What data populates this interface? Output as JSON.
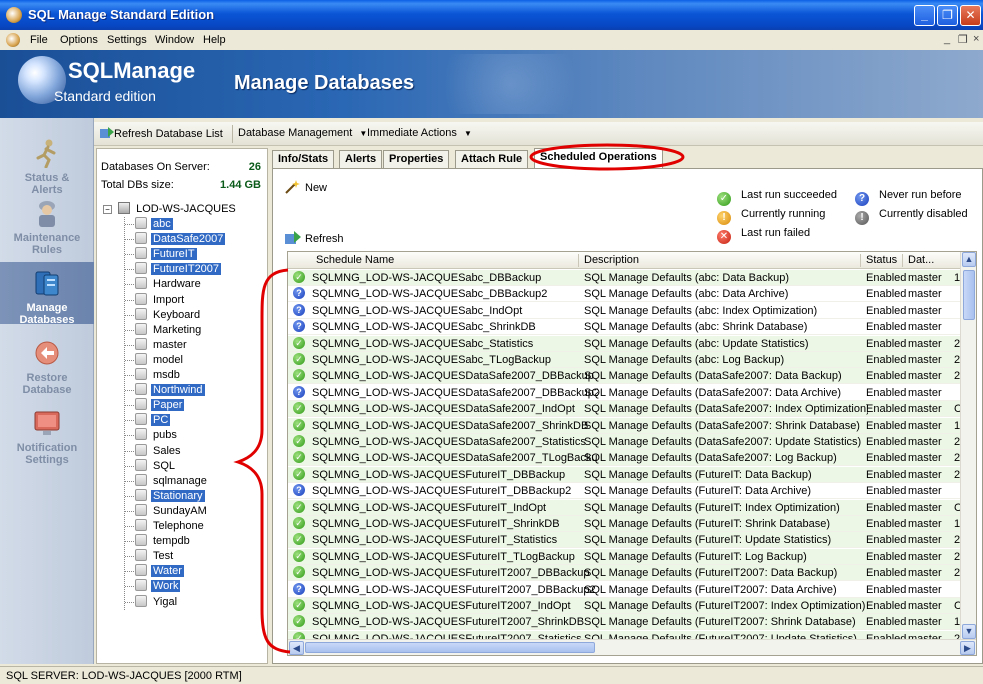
{
  "window": {
    "title": "SQL Manage Standard Edition"
  },
  "menu": {
    "items": [
      "File",
      "Options",
      "Settings",
      "Window",
      "Help"
    ]
  },
  "banner": {
    "brand": "SQLManage",
    "brand_sub": "Standard edition",
    "heading": "Manage Databases"
  },
  "nav": [
    {
      "label1": "Status &",
      "label2": "Alerts",
      "icon": "runner-icon",
      "active": false
    },
    {
      "label1": "Maintenance",
      "label2": "Rules",
      "icon": "worker-icon",
      "active": false
    },
    {
      "label1": "Manage",
      "label2": "Databases",
      "icon": "database-icon",
      "active": true
    },
    {
      "label1": "Restore",
      "label2": "Database",
      "icon": "restore-icon",
      "active": false
    },
    {
      "label1": "Notification",
      "label2": "Settings",
      "icon": "notification-icon",
      "active": false
    }
  ],
  "toolbar": {
    "refresh": "Refresh Database List",
    "db_mgmt": "Database Management",
    "immediate": "Immediate Actions"
  },
  "server_info": {
    "databases_label": "Databases On Server:",
    "databases_value": "26",
    "size_label": "Total DBs size:",
    "size_value": "1.44 GB",
    "server_name": "LOD-WS-JACQUES"
  },
  "databases": [
    {
      "name": "abc",
      "selected": true
    },
    {
      "name": "DataSafe2007",
      "selected": true
    },
    {
      "name": "FutureIT",
      "selected": true
    },
    {
      "name": "FutureIT2007",
      "selected": true
    },
    {
      "name": "Hardware",
      "selected": false
    },
    {
      "name": "Import",
      "selected": false
    },
    {
      "name": "Keyboard",
      "selected": false
    },
    {
      "name": "Marketing",
      "selected": false
    },
    {
      "name": "master",
      "selected": false
    },
    {
      "name": "model",
      "selected": false
    },
    {
      "name": "msdb",
      "selected": false
    },
    {
      "name": "Northwind",
      "selected": true
    },
    {
      "name": "Paper",
      "selected": true
    },
    {
      "name": "PC",
      "selected": true
    },
    {
      "name": "pubs",
      "selected": false
    },
    {
      "name": "Sales",
      "selected": false
    },
    {
      "name": "SQL",
      "selected": false
    },
    {
      "name": "sqlmanage",
      "selected": false
    },
    {
      "name": "Stationary",
      "selected": true
    },
    {
      "name": "SundayAM",
      "selected": false
    },
    {
      "name": "Telephone",
      "selected": false
    },
    {
      "name": "tempdb",
      "selected": false
    },
    {
      "name": "Test",
      "selected": false
    },
    {
      "name": "Water",
      "selected": true
    },
    {
      "name": "Work",
      "selected": true
    },
    {
      "name": "Yigal",
      "selected": false
    }
  ],
  "tabs": [
    {
      "label": "Info/Stats",
      "active": false
    },
    {
      "label": "Alerts",
      "active": false
    },
    {
      "label": "Properties",
      "active": false
    },
    {
      "label": "Attach Rule",
      "active": false
    },
    {
      "label": "Scheduled Operations",
      "active": true
    }
  ],
  "actions": {
    "new": "New",
    "refresh": "Refresh"
  },
  "legend": {
    "succeeded": "Last run succeeded",
    "never": "Never run before",
    "running": "Currently running",
    "disabled": "Currently disabled",
    "failed": "Last run failed"
  },
  "columns": [
    "Schedule Name",
    "Description",
    "Status",
    "Dat..."
  ],
  "schedules": [
    {
      "status_icon": "ok",
      "name": "SQLMNG_LOD-WS-JACQUESabc_DBBackup",
      "description": "SQL Manage Defaults (abc: Data Backup)",
      "status": "Enabled",
      "db": "master",
      "extra": "1"
    },
    {
      "status_icon": "never",
      "name": "SQLMNG_LOD-WS-JACQUESabc_DBBackup2",
      "description": "SQL Manage Defaults (abc: Data Archive)",
      "status": "Enabled",
      "db": "master",
      "extra": ""
    },
    {
      "status_icon": "never",
      "name": "SQLMNG_LOD-WS-JACQUESabc_IndOpt",
      "description": "SQL Manage Defaults (abc: Index Optimization)",
      "status": "Enabled",
      "db": "master",
      "extra": ""
    },
    {
      "status_icon": "never",
      "name": "SQLMNG_LOD-WS-JACQUESabc_ShrinkDB",
      "description": "SQL Manage Defaults (abc: Shrink Database)",
      "status": "Enabled",
      "db": "master",
      "extra": ""
    },
    {
      "status_icon": "ok",
      "name": "SQLMNG_LOD-WS-JACQUESabc_Statistics",
      "description": "SQL Manage Defaults (abc: Update Statistics)",
      "status": "Enabled",
      "db": "master",
      "extra": "2"
    },
    {
      "status_icon": "ok",
      "name": "SQLMNG_LOD-WS-JACQUESabc_TLogBackup",
      "description": "SQL Manage Defaults (abc: Log Backup)",
      "status": "Enabled",
      "db": "master",
      "extra": "2"
    },
    {
      "status_icon": "ok",
      "name": "SQLMNG_LOD-WS-JACQUESDataSafe2007_DBBackup",
      "description": "SQL Manage Defaults (DataSafe2007: Data Backup)",
      "status": "Enabled",
      "db": "master",
      "extra": "2"
    },
    {
      "status_icon": "never",
      "name": "SQLMNG_LOD-WS-JACQUESDataSafe2007_DBBackup2",
      "description": "SQL Manage Defaults (DataSafe2007: Data Archive)",
      "status": "Enabled",
      "db": "master",
      "extra": ""
    },
    {
      "status_icon": "ok",
      "name": "SQLMNG_LOD-WS-JACQUESDataSafe2007_IndOpt",
      "description": "SQL Manage Defaults (DataSafe2007: Index Optimization)",
      "status": "Enabled",
      "db": "master",
      "extra": "C"
    },
    {
      "status_icon": "ok",
      "name": "SQLMNG_LOD-WS-JACQUESDataSafe2007_ShrinkDB",
      "description": "SQL Manage Defaults (DataSafe2007: Shrink Database)",
      "status": "Enabled",
      "db": "master",
      "extra": "1"
    },
    {
      "status_icon": "ok",
      "name": "SQLMNG_LOD-WS-JACQUESDataSafe2007_Statistics",
      "description": "SQL Manage Defaults (DataSafe2007: Update Statistics)",
      "status": "Enabled",
      "db": "master",
      "extra": "2"
    },
    {
      "status_icon": "ok",
      "name": "SQLMNG_LOD-WS-JACQUESDataSafe2007_TLogBackup",
      "description": "SQL Manage Defaults (DataSafe2007: Log Backup)",
      "status": "Enabled",
      "db": "master",
      "extra": "2"
    },
    {
      "status_icon": "ok",
      "name": "SQLMNG_LOD-WS-JACQUESFutureIT_DBBackup",
      "description": "SQL Manage Defaults (FutureIT: Data Backup)",
      "status": "Enabled",
      "db": "master",
      "extra": "2"
    },
    {
      "status_icon": "never",
      "name": "SQLMNG_LOD-WS-JACQUESFutureIT_DBBackup2",
      "description": "SQL Manage Defaults (FutureIT: Data Archive)",
      "status": "Enabled",
      "db": "master",
      "extra": ""
    },
    {
      "status_icon": "ok",
      "name": "SQLMNG_LOD-WS-JACQUESFutureIT_IndOpt",
      "description": "SQL Manage Defaults (FutureIT: Index Optimization)",
      "status": "Enabled",
      "db": "master",
      "extra": "C"
    },
    {
      "status_icon": "ok",
      "name": "SQLMNG_LOD-WS-JACQUESFutureIT_ShrinkDB",
      "description": "SQL Manage Defaults (FutureIT: Shrink Database)",
      "status": "Enabled",
      "db": "master",
      "extra": "1"
    },
    {
      "status_icon": "ok",
      "name": "SQLMNG_LOD-WS-JACQUESFutureIT_Statistics",
      "description": "SQL Manage Defaults (FutureIT: Update Statistics)",
      "status": "Enabled",
      "db": "master",
      "extra": "2"
    },
    {
      "status_icon": "ok",
      "name": "SQLMNG_LOD-WS-JACQUESFutureIT_TLogBackup",
      "description": "SQL Manage Defaults (FutureIT: Log Backup)",
      "status": "Enabled",
      "db": "master",
      "extra": "2"
    },
    {
      "status_icon": "ok",
      "name": "SQLMNG_LOD-WS-JACQUESFutureIT2007_DBBackup",
      "description": "SQL Manage Defaults (FutureIT2007: Data Backup)",
      "status": "Enabled",
      "db": "master",
      "extra": "2"
    },
    {
      "status_icon": "never",
      "name": "SQLMNG_LOD-WS-JACQUESFutureIT2007_DBBackup2",
      "description": "SQL Manage Defaults (FutureIT2007: Data Archive)",
      "status": "Enabled",
      "db": "master",
      "extra": ""
    },
    {
      "status_icon": "ok",
      "name": "SQLMNG_LOD-WS-JACQUESFutureIT2007_IndOpt",
      "description": "SQL Manage Defaults (FutureIT2007: Index Optimization)",
      "status": "Enabled",
      "db": "master",
      "extra": "C"
    },
    {
      "status_icon": "ok",
      "name": "SQLMNG_LOD-WS-JACQUESFutureIT2007_ShrinkDB",
      "description": "SQL Manage Defaults (FutureIT2007: Shrink Database)",
      "status": "Enabled",
      "db": "master",
      "extra": "1"
    },
    {
      "status_icon": "ok",
      "name": "SQLMNG_LOD-WS-JACQUESFutureIT2007_Statistics",
      "description": "SQL Manage Defaults (FutureIT2007: Update Statistics)",
      "status": "Enabled",
      "db": "master",
      "extra": "2"
    }
  ],
  "statusbar": {
    "text": "SQL SERVER: LOD-WS-JACQUES [2000 RTM]"
  },
  "colors": {
    "selection": "#316ac5",
    "annotation": "#e00000",
    "title_blue": "#0a56d6"
  }
}
